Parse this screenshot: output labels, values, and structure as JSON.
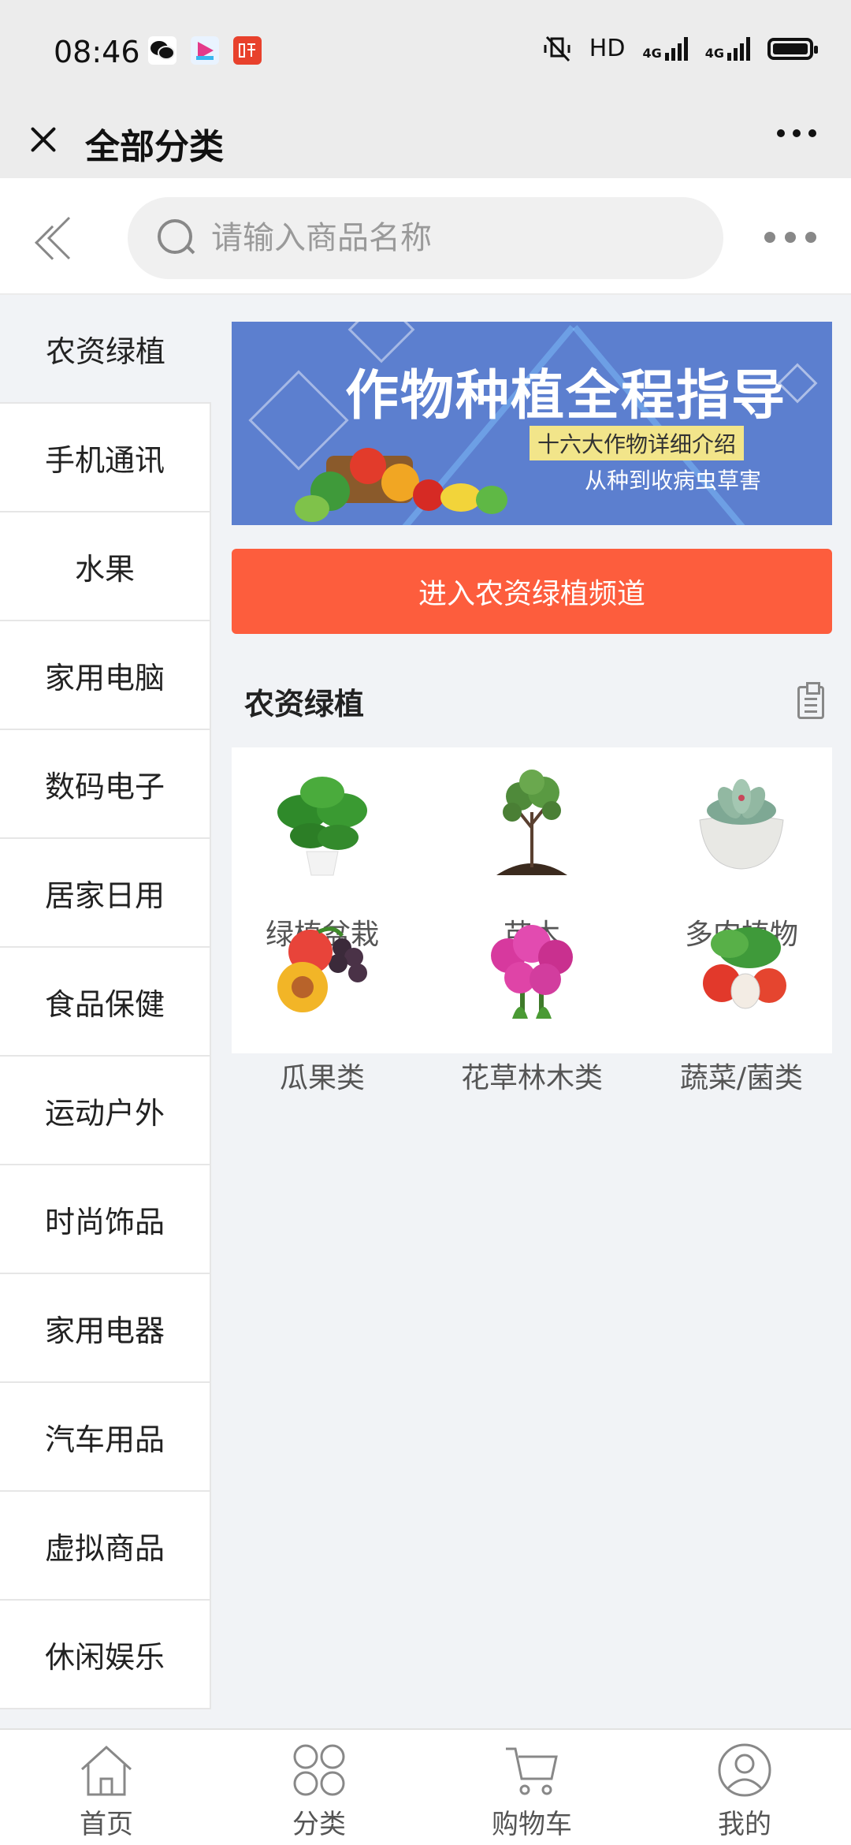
{
  "status_bar": {
    "time": "08:46",
    "right": "HD",
    "network_1": "4G",
    "network_2": "4G"
  },
  "title_bar": {
    "title": "全部分类"
  },
  "search": {
    "placeholder": "请输入商品名称"
  },
  "sidebar": {
    "items": [
      {
        "label": "农资绿植"
      },
      {
        "label": "手机通讯"
      },
      {
        "label": "水果"
      },
      {
        "label": "家用电脑"
      },
      {
        "label": "数码电子"
      },
      {
        "label": "居家日用"
      },
      {
        "label": "食品保健"
      },
      {
        "label": "运动户外"
      },
      {
        "label": "时尚饰品"
      },
      {
        "label": "家用电器"
      },
      {
        "label": "汽车用品"
      },
      {
        "label": "虚拟商品"
      },
      {
        "label": "休闲娱乐"
      }
    ]
  },
  "banner": {
    "title": "作物种植全程指导",
    "tag": "十六大作物详细介绍",
    "subtitle": "从种到收病虫草害"
  },
  "cta_label": "进入农资绿植频道",
  "section": {
    "title": "农资绿植",
    "items": [
      {
        "label": "绿植盆栽",
        "icon": "potted-plant-image"
      },
      {
        "label": "苗木",
        "icon": "sapling-image"
      },
      {
        "label": "多肉植物",
        "icon": "succulent-image"
      },
      {
        "label": "瓜果类",
        "icon": "fruits-image"
      },
      {
        "label": "花草林木类",
        "icon": "flowers-image"
      },
      {
        "label": "蔬菜/菌类",
        "icon": "vegetables-image"
      }
    ]
  },
  "tabbar": {
    "items": [
      {
        "label": "首页"
      },
      {
        "label": "分类"
      },
      {
        "label": "购物车"
      },
      {
        "label": "我的"
      }
    ]
  },
  "colors": {
    "accent": "#fd5d3d",
    "banner_bg": "#5c7fcf",
    "page_bg": "#f1f3f6"
  }
}
